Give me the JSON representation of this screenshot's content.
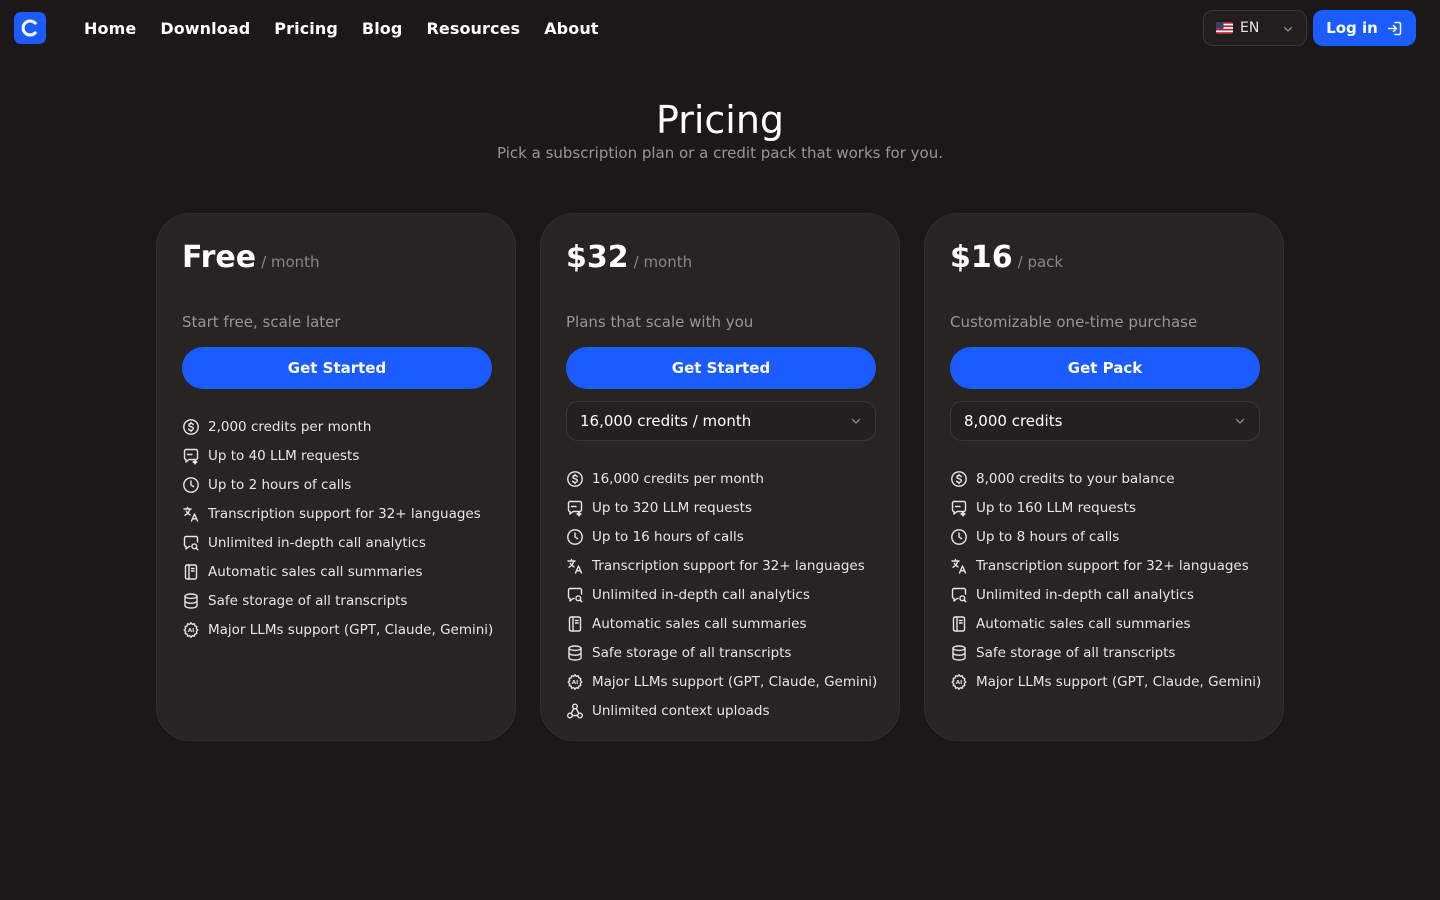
{
  "nav": {
    "links": [
      "Home",
      "Download",
      "Pricing",
      "Blog",
      "Resources",
      "About"
    ],
    "language": "EN",
    "login_label": "Log in",
    "accent": "#1a5cff"
  },
  "header": {
    "title": "Pricing",
    "subtitle": "Pick a subscription plan or a credit pack that works for you."
  },
  "plans": [
    {
      "price": "Free",
      "period": "/ month",
      "description": "Start free, scale later",
      "cta": "Get Started",
      "features": [
        {
          "icon": "dollar-icon",
          "text": "2,000 credits per month"
        },
        {
          "icon": "chat-spark-icon",
          "text": "Up to 40 LLM requests"
        },
        {
          "icon": "clock-icon",
          "text": "Up to 2 hours of calls"
        },
        {
          "icon": "translate-icon",
          "text": "Transcription support for 32+ languages"
        },
        {
          "icon": "chat-search-icon",
          "text": "Unlimited in-depth call analytics"
        },
        {
          "icon": "notebook-icon",
          "text": "Automatic sales call summaries"
        },
        {
          "icon": "database-icon",
          "text": "Safe storage of all transcripts"
        },
        {
          "icon": "ai-gear-icon",
          "text": "Major LLMs support (GPT, Claude, Gemini)"
        }
      ]
    },
    {
      "price": "$32",
      "period": "/ month",
      "description": "Plans that scale with you",
      "cta": "Get Started",
      "select_value": "16,000 credits / month",
      "features": [
        {
          "icon": "dollar-icon",
          "text": "16,000 credits per month"
        },
        {
          "icon": "chat-spark-icon",
          "text": "Up to 320 LLM requests"
        },
        {
          "icon": "clock-icon",
          "text": "Up to 16 hours of calls"
        },
        {
          "icon": "translate-icon",
          "text": "Transcription support for 32+ languages"
        },
        {
          "icon": "chat-search-icon",
          "text": "Unlimited in-depth call analytics"
        },
        {
          "icon": "notebook-icon",
          "text": "Automatic sales call summaries"
        },
        {
          "icon": "database-icon",
          "text": "Safe storage of all transcripts"
        },
        {
          "icon": "ai-gear-icon",
          "text": "Major LLMs support (GPT, Claude, Gemini)"
        },
        {
          "icon": "network-icon",
          "text": "Unlimited context uploads"
        }
      ]
    },
    {
      "price": "$16",
      "period": "/ pack",
      "description": "Customizable one-time purchase",
      "cta": "Get Pack",
      "select_value": "8,000 credits",
      "features": [
        {
          "icon": "dollar-icon",
          "text": "8,000 credits to your balance"
        },
        {
          "icon": "chat-spark-icon",
          "text": "Up to 160 LLM requests"
        },
        {
          "icon": "clock-icon",
          "text": "Up to 8 hours of calls"
        },
        {
          "icon": "translate-icon",
          "text": "Transcription support for 32+ languages"
        },
        {
          "icon": "chat-search-icon",
          "text": "Unlimited in-depth call analytics"
        },
        {
          "icon": "notebook-icon",
          "text": "Automatic sales call summaries"
        },
        {
          "icon": "database-icon",
          "text": "Safe storage of all transcripts"
        },
        {
          "icon": "ai-gear-icon",
          "text": "Major LLMs support (GPT, Claude, Gemini)"
        }
      ]
    }
  ]
}
